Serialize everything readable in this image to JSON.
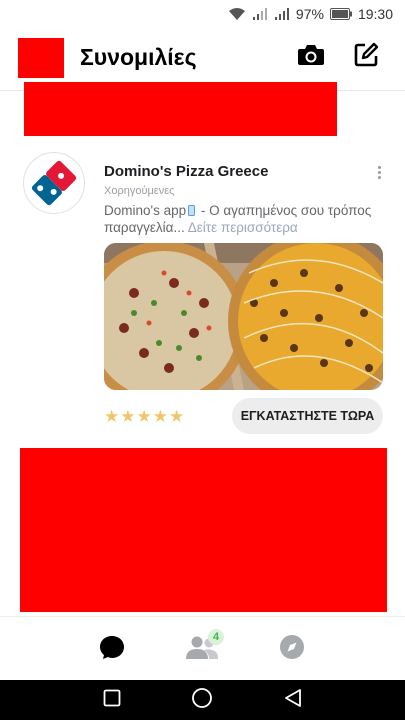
{
  "status_bar": {
    "battery": "97%",
    "time": "19:30"
  },
  "header": {
    "title": "Συνομιλίες"
  },
  "ad": {
    "name": "Domino's Pizza Greece",
    "sponsored": "Χορηγούμενες",
    "description_part1": "Domino's app",
    "description_part2": " - Ο αγαπημένος σου τρόπος παραγγελία...",
    "see_more": "Δείτε περισσότερα",
    "stars": [
      "★",
      "★",
      "★",
      "★",
      "★"
    ],
    "cta": "ΕΓΚΑΤΑΣΤΗΣΤΕ ΤΩΡΑ"
  },
  "tabbar": {
    "people_badge": "4"
  },
  "colors": {
    "redaction": "#ff0000",
    "brand_blue": "#006491",
    "brand_red": "#e31837",
    "badge_green": "#44b54a"
  },
  "icons": [
    "wifi-icon",
    "signal-icon",
    "battery-icon",
    "camera-icon",
    "compose-icon",
    "more-icon",
    "chat-icon",
    "people-icon",
    "compass-icon",
    "recent-apps-icon",
    "home-icon",
    "back-icon"
  ]
}
